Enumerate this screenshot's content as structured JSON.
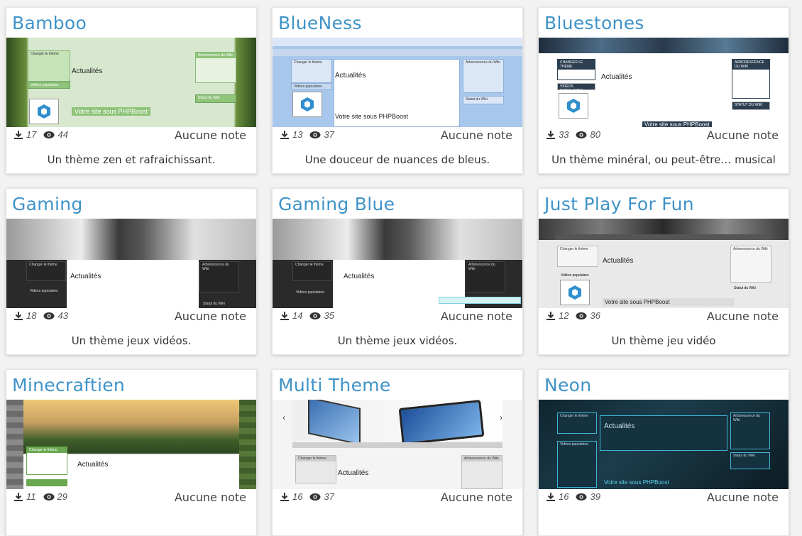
{
  "themes": [
    {
      "name": "Bamboo",
      "downloads": "17",
      "views": "44",
      "rating": "Aucune note",
      "description": "Un thème zen et rafraichissant.",
      "mini_title": "Actualités",
      "mini_site": "Votre site sous PHPBoost",
      "mini_left": "Changer le thème",
      "mini_left2": "Vidéos populaires",
      "mini_right": "Arborescence du Wiki",
      "mini_right2": "Statut du Wiki"
    },
    {
      "name": "BlueNess",
      "downloads": "13",
      "views": "37",
      "rating": "Aucune note",
      "description": "Une douceur de nuances de bleus.",
      "mini_title": "Actualités",
      "mini_site": "Votre site sous PHPBoost",
      "mini_left": "Changer le thème",
      "mini_left2": "Vidéos populaires",
      "mini_right": "Arborescence du Wiki",
      "mini_right2": "Statut du Wiki"
    },
    {
      "name": "Bluestones",
      "downloads": "33",
      "views": "80",
      "rating": "Aucune note",
      "description": "Un thème minéral, ou peut-être… musical",
      "mini_title": "Actualités",
      "mini_site": "Votre site sous PHPBoost",
      "mini_left": "CHANGER LE THÈME",
      "mini_left2": "VIDÉOS POPULAIRES",
      "mini_right": "ARBORESCENCE DU WIKI",
      "mini_right2": "STATUT DU WIKI"
    },
    {
      "name": "Gaming",
      "downloads": "18",
      "views": "43",
      "rating": "Aucune note",
      "description": "Un thème jeux vidéos.",
      "mini_title": "Actualités",
      "mini_site": "",
      "mini_left": "Changer le thème",
      "mini_left2": "Vidéos populaires",
      "mini_right": "Arborescence du Wiki",
      "mini_right2": "Statut du Wiki"
    },
    {
      "name": "Gaming Blue",
      "downloads": "14",
      "views": "35",
      "rating": "Aucune note",
      "description": "Un thème jeux vidéos.",
      "mini_title": "Actualités",
      "mini_site": "",
      "mini_left": "Changer le thème",
      "mini_left2": "Vidéos populaires",
      "mini_right": "Arborescence du Wiki",
      "mini_right2": "Statut du Wiki"
    },
    {
      "name": "Just Play For Fun",
      "downloads": "12",
      "views": "36",
      "rating": "Aucune note",
      "description": "Un thème jeu vidéo",
      "mini_title": "Actualités",
      "mini_site": "Votre site sous PHPBoost",
      "mini_left": "Changer le thème",
      "mini_left2": "Vidéos populaires",
      "mini_right": "Arborescence du Wiki",
      "mini_right2": "Statut du Wiki"
    },
    {
      "name": "Minecraftien",
      "downloads": "11",
      "views": "29",
      "rating": "Aucune note",
      "description": "",
      "mini_title": "Actualités",
      "mini_site": "",
      "mini_left": "Changer le thème",
      "mini_left2": "",
      "mini_right": "",
      "mini_right2": ""
    },
    {
      "name": "Multi Theme",
      "downloads": "16",
      "views": "37",
      "rating": "Aucune note",
      "description": "",
      "mini_title": "Actualités",
      "mini_site": "",
      "mini_left": "Changer le thème",
      "mini_left2": "",
      "mini_right": "Arborescence du Wiki",
      "mini_right2": ""
    },
    {
      "name": "Neon",
      "downloads": "16",
      "views": "39",
      "rating": "Aucune note",
      "description": "",
      "mini_title": "Actualités",
      "mini_site": "Votre site sous PHPBoost",
      "mini_left": "Changer le thème",
      "mini_left2": "Vidéos populaires",
      "mini_right": "Arborescence du Wiki",
      "mini_right2": "Statut du Wiki"
    }
  ],
  "colors": {
    "title": "#3f93c8",
    "card_bg": "#ffffff",
    "page_bg": "#f2f2f2"
  }
}
